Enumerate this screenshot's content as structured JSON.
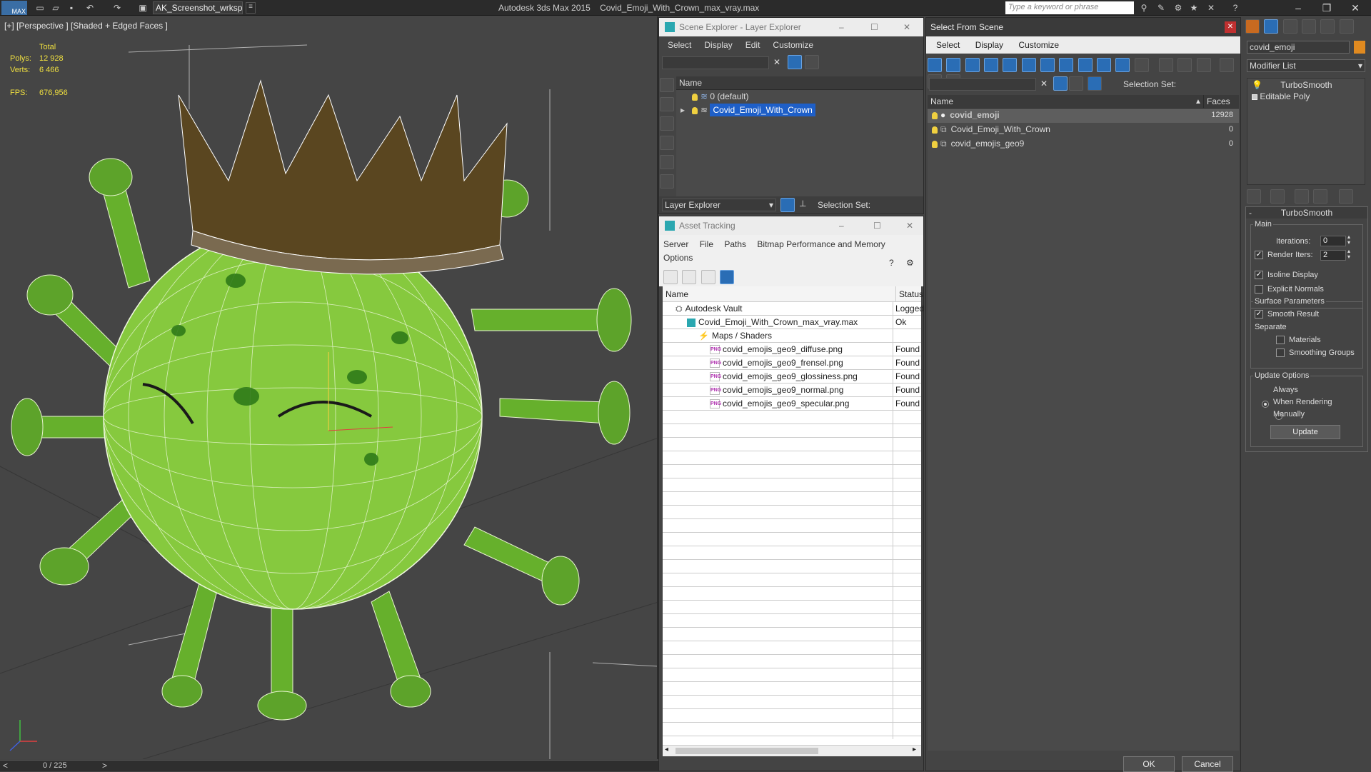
{
  "titlebar": {
    "logo": "MAX",
    "workspace": "AK_Screenshot_wrksp",
    "app_title": "Autodesk 3ds Max  2015",
    "file_name": "Covid_Emoji_With_Crown_max_vray.max",
    "search_placeholder": "Type a keyword or phrase"
  },
  "viewport": {
    "label": "[+] [Perspective ] [Shaded + Edged Faces ]",
    "stats": {
      "total_label": "Total",
      "polys_label": "Polys:",
      "polys_value": "12 928",
      "verts_label": "Verts:",
      "verts_value": "6 466",
      "fps_label": "FPS:",
      "fps_value": "676,956"
    },
    "timeline": "0 / 225"
  },
  "scene_explorer": {
    "title": "Scene Explorer - Layer Explorer",
    "menu": [
      "Select",
      "Display",
      "Edit",
      "Customize"
    ],
    "col_name": "Name",
    "layers": [
      "0 (default)",
      "Covid_Emoji_With_Crown"
    ],
    "footer_dropdown": "Layer Explorer",
    "selection_set_label": "Selection Set:"
  },
  "asset_tracking": {
    "title": "Asset Tracking",
    "menu": [
      "Server",
      "File",
      "Paths",
      "Bitmap Performance and Memory",
      "Options"
    ],
    "col_name": "Name",
    "col_status": "Status",
    "rows": [
      {
        "name": "Autodesk Vault",
        "status": "Logged",
        "indent": 0
      },
      {
        "name": "Covid_Emoji_With_Crown_max_vray.max",
        "status": "Ok",
        "indent": 1
      },
      {
        "name": "Maps / Shaders",
        "status": "",
        "indent": 2
      },
      {
        "name": "covid_emojis_geo9_diffuse.png",
        "status": "Found",
        "indent": 3
      },
      {
        "name": "covid_emojis_geo9_frensel.png",
        "status": "Found",
        "indent": 3
      },
      {
        "name": "covid_emojis_geo9_glossiness.png",
        "status": "Found",
        "indent": 3
      },
      {
        "name": "covid_emojis_geo9_normal.png",
        "status": "Found",
        "indent": 3
      },
      {
        "name": "covid_emojis_geo9_specular.png",
        "status": "Found",
        "indent": 3
      }
    ]
  },
  "select_from_scene": {
    "title": "Select From Scene",
    "menu": [
      "Select",
      "Display",
      "Customize"
    ],
    "selection_set_label": "Selection Set:",
    "col_name": "Name",
    "col_faces": "Faces",
    "objects": [
      {
        "name": "covid_emoji",
        "faces": "12928"
      },
      {
        "name": "Covid_Emoji_With_Crown",
        "faces": "0"
      },
      {
        "name": "covid_emojis_geo9",
        "faces": "0"
      }
    ],
    "ok": "OK",
    "cancel": "Cancel"
  },
  "command_panel": {
    "object_name": "covid_emoji",
    "modifier_list": "Modifier List",
    "stack": [
      "TurboSmooth",
      "Editable Poly"
    ],
    "rollout_title": "TurboSmooth",
    "main_label": "Main",
    "iterations_label": "Iterations:",
    "iterations_value": "0",
    "render_iters_label": "Render Iters:",
    "render_iters_value": "2",
    "isoline_label": "Isoline Display",
    "explicit_normals_label": "Explicit Normals",
    "surface_params_label": "Surface Parameters",
    "smooth_result_label": "Smooth Result",
    "separate_label": "Separate",
    "materials_label": "Materials",
    "smoothing_groups_label": "Smoothing Groups",
    "update_options_label": "Update Options",
    "always_label": "Always",
    "when_rendering_label": "When Rendering",
    "manually_label": "Manually",
    "update_button": "Update"
  },
  "colors": {
    "selection_blue": "#1e5fc8",
    "virus_green": "#7cc23a",
    "crown_brown": "#5a4620",
    "stats_yellow": "#f0e040"
  }
}
